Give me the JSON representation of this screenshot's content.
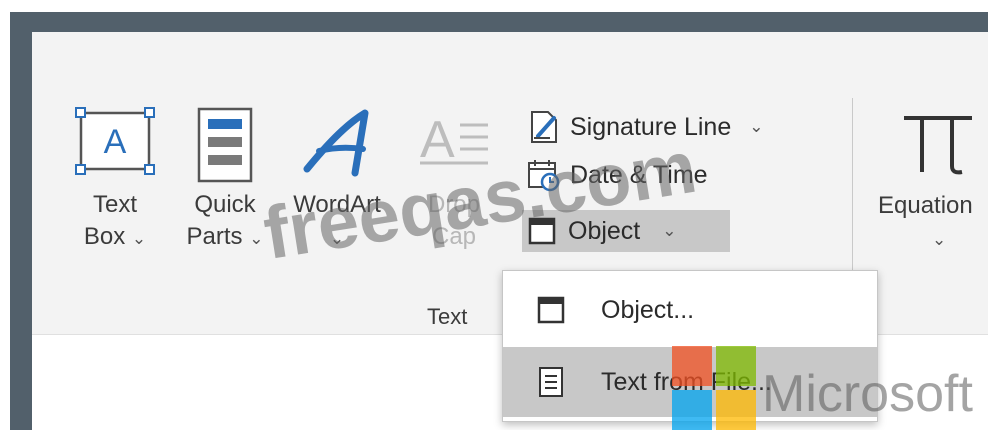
{
  "ribbon": {
    "group_text": {
      "label": "Text",
      "text_box": {
        "line1": "Text",
        "line2": "Box"
      },
      "quick_parts": {
        "line1": "Quick",
        "line2": "Parts"
      },
      "wordart": {
        "line1": "WordArt"
      },
      "drop_cap": {
        "line1": "Drop",
        "line2": "Cap"
      },
      "signature_line": "Signature Line",
      "date_time": "Date & Time",
      "object": "Object"
    },
    "equation": {
      "line1": "Equation"
    }
  },
  "object_menu": {
    "items": [
      {
        "label": "Object..."
      },
      {
        "label": "Text from File..."
      }
    ]
  },
  "watermark": {
    "text": "freeqas.com",
    "brand": "Microsoft"
  },
  "colors": {
    "frame": "#52606b",
    "ribbon": "#f3f3f3",
    "accent_blue": "#2a6fba",
    "highlight": "#c8c8c8"
  }
}
